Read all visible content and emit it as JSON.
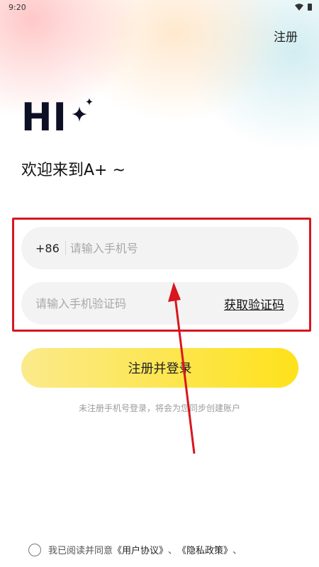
{
  "status_bar": {
    "time": "9:20"
  },
  "header": {
    "register_link": "注册"
  },
  "logo": {
    "text": "HI"
  },
  "welcome": "欢迎来到A+ ~",
  "phone_field": {
    "country_code": "+86",
    "placeholder": "请输入手机号",
    "value": ""
  },
  "code_field": {
    "placeholder": "请输入手机验证码",
    "value": "",
    "get_code_label": "获取验证码"
  },
  "submit": {
    "label": "注册并登录"
  },
  "hint": "未注册手机号登录，将会为您同步创建账户",
  "agreement": {
    "prefix": "我已阅读并同意",
    "user_agreement": "《用户协议》",
    "sep1": "、",
    "privacy_policy": "《隐私政策》",
    "sep2": "、",
    "checked": false
  },
  "colors": {
    "accent_yellow": "#fee21b",
    "highlight_red": "#d8161e",
    "logo_dark": "#0d0f24"
  }
}
